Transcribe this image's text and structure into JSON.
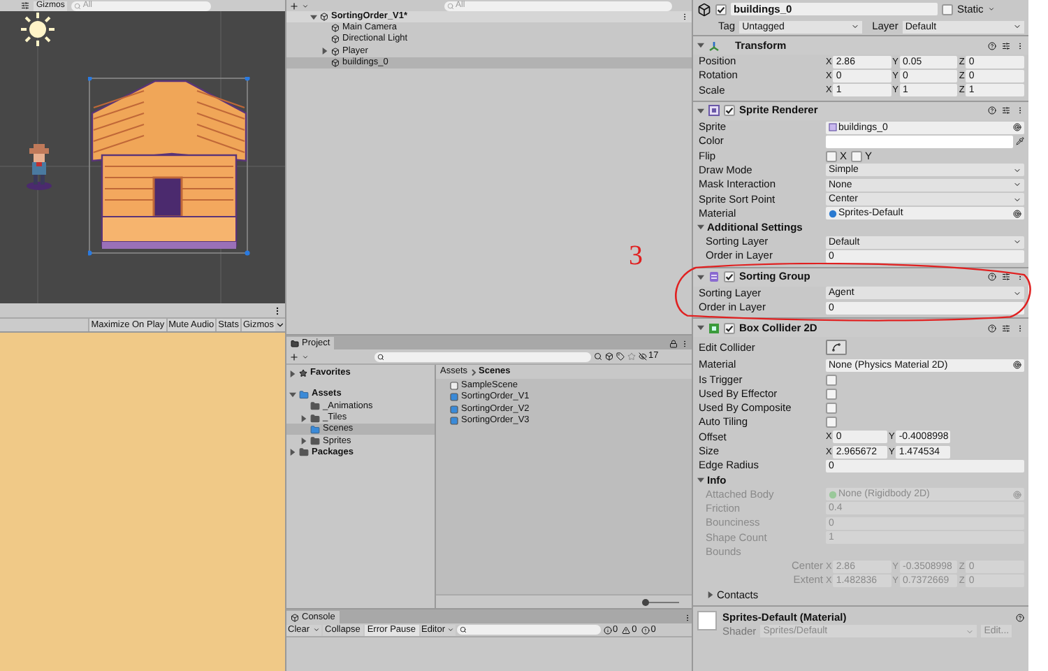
{
  "scene_view": {
    "gizmos": "Gizmos",
    "search_placeholder": "All"
  },
  "game_view": {
    "buttons": [
      {
        "label": "Maximize On Play",
        "selected": false
      },
      {
        "label": "Mute Audio",
        "selected": false
      },
      {
        "label": "Stats",
        "selected": false
      },
      {
        "label": "Gizmos",
        "selected": false
      }
    ]
  },
  "hierarchy": {
    "search_placeholder": "All",
    "scene": "SortingOrder_V1*",
    "items": [
      {
        "label": "Main Camera",
        "selected": false
      },
      {
        "label": "Directional Light",
        "selected": false
      },
      {
        "label": "Player",
        "selected": false,
        "expanded": false
      },
      {
        "label": "buildings_0",
        "selected": true
      }
    ]
  },
  "project": {
    "tab": "Project",
    "count": "17",
    "tree": [
      {
        "label": "Favorites",
        "expanded": false,
        "kind": "favorites",
        "selected": false
      },
      {
        "label": "Assets",
        "expanded": true,
        "kind": "assets",
        "selected": false,
        "children": [
          {
            "label": "_Animations",
            "kind": "folder",
            "selected": false
          },
          {
            "label": "_Tiles",
            "kind": "folder",
            "expanded": false,
            "selected": false
          },
          {
            "label": "Scenes",
            "kind": "folder-blue",
            "selected": true
          },
          {
            "label": "Sprites",
            "kind": "folder",
            "expanded": false,
            "selected": false
          }
        ]
      },
      {
        "label": "Packages",
        "expanded": false,
        "kind": "folder",
        "selected": false
      }
    ],
    "breadcrumb": [
      "Assets",
      "Scenes"
    ],
    "zoom_slider": {
      "level": 0
    },
    "files": [
      {
        "label": "SampleScene",
        "kind": "scene"
      },
      {
        "label": "SortingOrder_V1",
        "kind": "scene-blue"
      },
      {
        "label": "SortingOrder_V2",
        "kind": "scene-blue"
      },
      {
        "label": "SortingOrder_V3",
        "kind": "scene-blue"
      }
    ]
  },
  "console": {
    "tab": "Console",
    "buttons": [
      {
        "label": "Clear",
        "kind": "split"
      },
      {
        "label": "Collapse",
        "kind": "toggle",
        "selected": false
      },
      {
        "label": "Error Pause",
        "kind": "toggle",
        "selected": true
      },
      {
        "label": "Editor",
        "kind": "dropdown"
      }
    ],
    "counts": [
      {
        "kind": "info",
        "value": "0"
      },
      {
        "kind": "warning",
        "value": "0"
      },
      {
        "kind": "error",
        "value": "0"
      }
    ]
  },
  "inspector": {
    "name": "buildings_0",
    "active": true,
    "static_label": "Static",
    "static": false,
    "tag_label": "Tag",
    "tag": "Untagged",
    "layer_label": "Layer",
    "layer": "Default",
    "components": [
      {
        "title": "Transform",
        "kind": "transform",
        "rows": [
          {
            "kind": "vector",
            "label": "Position",
            "values": [
              {
                "axis": "X",
                "value": "2.86"
              },
              {
                "axis": "Y",
                "value": "0.05"
              },
              {
                "axis": "Z",
                "value": "0"
              }
            ]
          },
          {
            "kind": "vector",
            "label": "Rotation",
            "values": [
              {
                "axis": "X",
                "value": "0"
              },
              {
                "axis": "Y",
                "value": "0"
              },
              {
                "axis": "Z",
                "value": "0"
              }
            ]
          },
          {
            "kind": "vector",
            "label": "Scale",
            "values": [
              {
                "axis": "X",
                "value": "1"
              },
              {
                "axis": "Y",
                "value": "1"
              },
              {
                "axis": "Z",
                "value": "1"
              }
            ]
          }
        ]
      },
      {
        "title": "Sprite Renderer",
        "kind": "sprite",
        "enabled": true,
        "rows": [
          {
            "kind": "sprite-ref",
            "label": "Sprite",
            "value": "buildings_0"
          },
          {
            "kind": "color",
            "label": "Color",
            "color": "#ffffff"
          },
          {
            "kind": "flip",
            "label": "Flip",
            "options": [
              {
                "label": "X",
                "checked": false
              },
              {
                "label": "Y",
                "checked": false
              }
            ]
          },
          {
            "kind": "dropdown",
            "label": "Draw Mode",
            "value": "Simple"
          },
          {
            "kind": "dropdown",
            "label": "Mask Interaction",
            "value": "None"
          },
          {
            "kind": "dropdown",
            "label": "Sprite Sort Point",
            "value": "Center"
          },
          {
            "kind": "material-ref",
            "label": "Material",
            "value": "Sprites-Default"
          },
          {
            "kind": "section",
            "label": "Additional Settings",
            "expanded": true
          },
          {
            "kind": "dropdown",
            "label": "Sorting Layer",
            "value": "Default",
            "indent": true
          },
          {
            "kind": "text",
            "label": "Order in Layer",
            "value": "0",
            "indent": true
          }
        ]
      },
      {
        "title": "Sorting Group",
        "kind": "group",
        "enabled": true,
        "rows": [
          {
            "kind": "dropdown",
            "label": "Sorting Layer",
            "value": "Agent"
          },
          {
            "kind": "text",
            "label": "Order in Layer",
            "value": "0"
          }
        ]
      },
      {
        "title": "Box Collider 2D",
        "kind": "collider",
        "enabled": true,
        "rows": [
          {
            "kind": "button",
            "label": "Edit Collider"
          },
          {
            "kind": "object",
            "label": "Material",
            "value": "None (Physics Material 2D)"
          },
          {
            "kind": "checkbox",
            "label": "Is Trigger",
            "checked": false
          },
          {
            "kind": "checkbox",
            "label": "Used By Effector",
            "checked": false
          },
          {
            "kind": "checkbox",
            "label": "Used By Composite",
            "checked": false
          },
          {
            "kind": "checkbox",
            "label": "Auto Tiling",
            "checked": false
          },
          {
            "kind": "vector",
            "label": "Offset",
            "values": [
              {
                "axis": "X",
                "value": "0"
              },
              {
                "axis": "Y",
                "value": "-0.4008998"
              }
            ]
          },
          {
            "kind": "vector",
            "label": "Size",
            "values": [
              {
                "axis": "X",
                "value": "2.965672"
              },
              {
                "axis": "Y",
                "value": "1.474534"
              }
            ]
          },
          {
            "kind": "text",
            "label": "Edge Radius",
            "value": "0"
          },
          {
            "kind": "section",
            "label": "Info",
            "expanded": true
          },
          {
            "kind": "body-ref",
            "label": "Attached Body",
            "value": "None (Rigidbody 2D)",
            "disabled": true,
            "indent": true
          },
          {
            "kind": "text",
            "label": "Friction",
            "value": "0.4",
            "disabled": true,
            "indent": true
          },
          {
            "kind": "text",
            "label": "Bounciness",
            "value": "0",
            "disabled": true,
            "indent": true
          },
          {
            "kind": "text",
            "label": "Shape Count",
            "value": "1",
            "disabled": true,
            "indent": true
          },
          {
            "kind": "label",
            "label": "Bounds",
            "disabled": true,
            "indent": true
          },
          {
            "kind": "vector",
            "label": "Center",
            "values": [
              {
                "axis": "X",
                "value": "2.86"
              },
              {
                "axis": "Y",
                "value": "-0.3508998"
              },
              {
                "axis": "Z",
                "value": "0"
              }
            ],
            "disabled": true,
            "right": true
          },
          {
            "kind": "vector",
            "label": "Extent",
            "values": [
              {
                "axis": "X",
                "value": "1.482836"
              },
              {
                "axis": "Y",
                "value": "0.7372669"
              },
              {
                "axis": "Z",
                "value": "0"
              }
            ],
            "disabled": true,
            "right": true
          },
          {
            "kind": "section",
            "label": "Contacts",
            "expanded": false,
            "indent": true
          }
        ]
      }
    ],
    "material": {
      "title": "Sprites-Default (Material)",
      "shader_label": "Shader",
      "shader": "Sprites/Default",
      "edit": "Edit..."
    }
  },
  "annotation": {
    "text": "3"
  }
}
